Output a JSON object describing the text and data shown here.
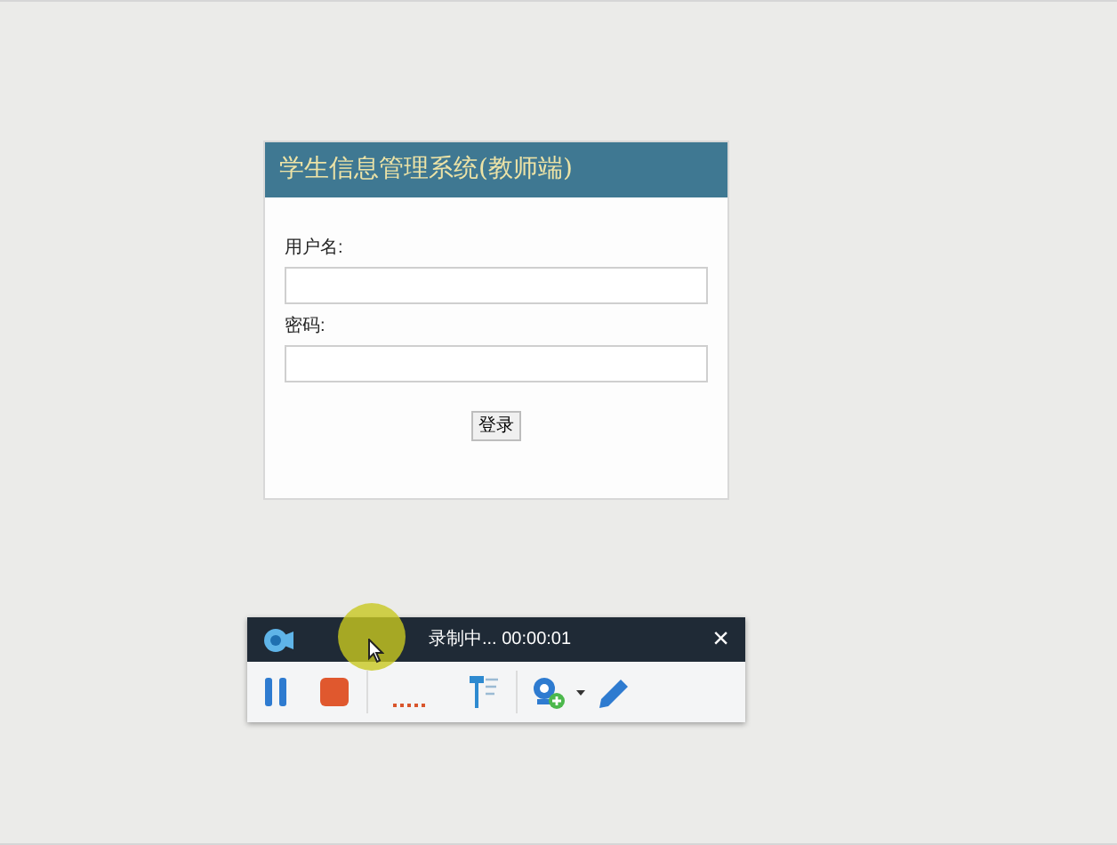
{
  "login": {
    "title": "学生信息管理系统(教师端)",
    "fields": [
      {
        "label": "用户名:"
      },
      {
        "label": "密码:"
      }
    ],
    "button": "登录"
  },
  "recorder": {
    "status": "录制中... 00:00:01",
    "close": "×"
  }
}
